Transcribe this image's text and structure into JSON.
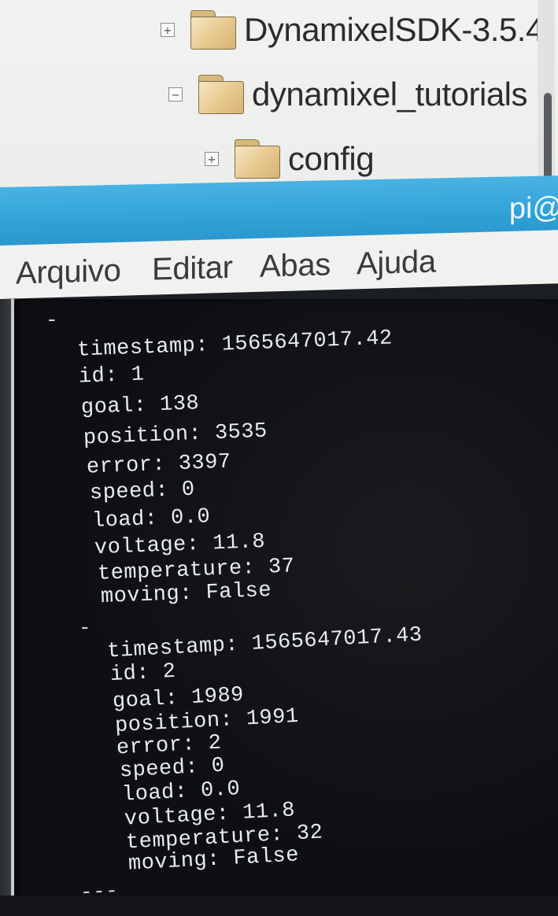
{
  "file_tree": {
    "items": [
      {
        "label": "DynamixelSDK-3.5.4",
        "expander": "+",
        "icon": "folder-icon"
      },
      {
        "label": "dynamixel_tutorials",
        "expander": "−",
        "icon": "folder-icon"
      },
      {
        "label": "config",
        "expander": "+",
        "icon": "folder-icon"
      }
    ]
  },
  "terminal": {
    "title": "pi@",
    "menu": [
      "Arquivo",
      "Editar",
      "Abas",
      "Ajuda"
    ],
    "separator": "-",
    "entries": [
      {
        "lines": [
          "timestamp: 1565647017.42",
          "id: 1",
          "goal: 138",
          "position: 3535",
          "error: 3397",
          "speed: 0",
          "load: 0.0",
          "voltage: 11.8",
          "temperature: 37",
          "moving: False"
        ]
      },
      {
        "lines": [
          "timestamp: 1565647017.43",
          "id: 2",
          "goal: 1989",
          "position: 1991",
          "error: 2",
          "speed: 0",
          "load: 0.0",
          "voltage: 11.8",
          "temperature: 32",
          "moving: False"
        ]
      }
    ],
    "end_marker": "---"
  },
  "colors": {
    "titlebar": "#2fa0d6",
    "terminal_bg": "#0d0f12",
    "terminal_fg": "#e9ecef",
    "menubar_bg": "#f1f2ef"
  }
}
